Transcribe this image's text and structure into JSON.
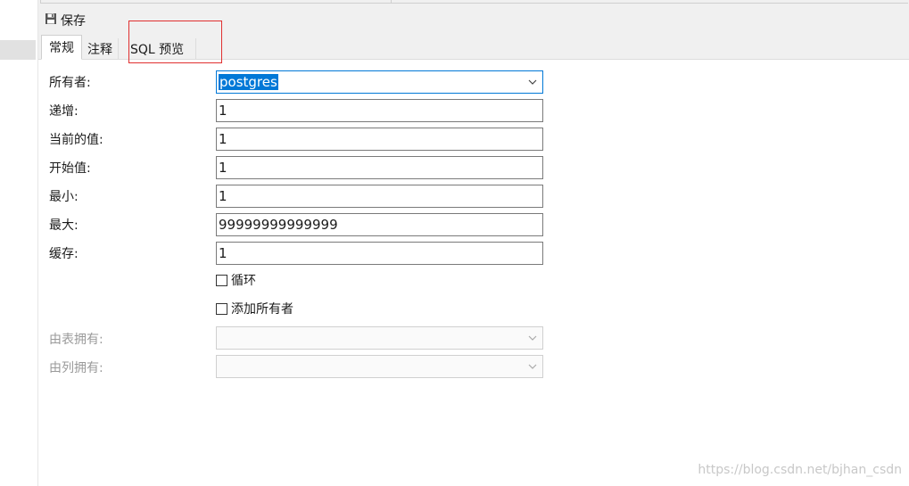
{
  "toolbar": {
    "save_label": "保存",
    "save_icon": "floppy-disk-icon"
  },
  "tabs": [
    {
      "label": "常规",
      "active": true
    },
    {
      "label": "注释",
      "active": false
    },
    {
      "label": "SQL 预览",
      "active": false
    }
  ],
  "form": {
    "owner": {
      "label": "所有者:",
      "value": "postgres"
    },
    "increment": {
      "label": "递增:",
      "value": "1"
    },
    "current_value": {
      "label": "当前的值:",
      "value": "1"
    },
    "start": {
      "label": "开始值:",
      "value": "1"
    },
    "min": {
      "label": "最小:",
      "value": "1"
    },
    "max": {
      "label": "最大:",
      "value": "99999999999999"
    },
    "cache": {
      "label": "缓存:",
      "value": "1"
    },
    "cycle": {
      "label": "循环",
      "checked": false
    },
    "add_owner": {
      "label": "添加所有者",
      "checked": false
    },
    "owned_by_table": {
      "label": "由表拥有:",
      "value": ""
    },
    "owned_by_column": {
      "label": "由列拥有:",
      "value": ""
    }
  },
  "watermark": "https://blog.csdn.net/bjhan_csdn",
  "colors": {
    "accent": "#0078d7",
    "highlight_box": "#e03030"
  }
}
